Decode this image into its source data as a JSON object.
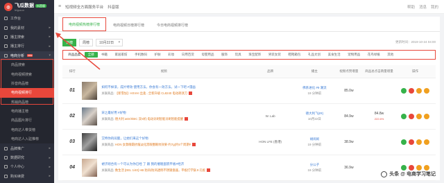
{
  "brand": {
    "name": "飞瓜数据",
    "badge": "抖音版",
    "sub": "feigua.cn"
  },
  "topbar": {
    "menu_icon": "menu-icon",
    "nav1": "短视频全方面服务平台",
    "nav2": "抖音版",
    "right1": "帮助",
    "right2": "消息",
    "right3": "我的"
  },
  "sidebar": {
    "items": [
      {
        "label": "工作台",
        "icon": "desk-icon"
      },
      {
        "label": "我的素材",
        "icon": "folder-icon",
        "arrow": "▸"
      },
      {
        "label": "播主搜索",
        "icon": "search-icon",
        "arrow": "▸"
      },
      {
        "label": "播主排行",
        "icon": "rank-icon",
        "arrow": "▸"
      },
      {
        "label": "电商分析",
        "icon": "cart-icon",
        "arrow": "▾",
        "new": "new"
      }
    ],
    "subitems": [
      "商品搜索",
      "电商视频搜索",
      "抖音商品榜",
      "电商视频排行",
      "热销商品榜",
      "电商播主榜",
      "商品图片排行",
      "电商达人带货榜",
      "电商达人入驻推荐"
    ],
    "items_after": [
      {
        "label": "品牌推广",
        "icon": "brand-icon",
        "arrow": "▸"
      },
      {
        "label": "数据研究",
        "icon": "data-icon",
        "arrow": "▸"
      },
      {
        "label": "个人中心",
        "icon": "user-icon",
        "arrow": "▸"
      },
      {
        "label": "购买续费",
        "icon": "wallet-icon",
        "arrow": "▸"
      }
    ]
  },
  "tabs": [
    "电商视频热榜排行榜",
    "电商视频日榜排行榜",
    "今日电商视频排行榜"
  ],
  "filters": {
    "day": "日榜",
    "week": "周榜",
    "date": "10月22日",
    "updated": "更新时间：2019-10-24 04:00"
  },
  "categories": {
    "label": "商品品类",
    "items": [
      "全部",
      "书籍",
      "家居家纺",
      "手机数码",
      "护肤",
      "彩妆",
      "日用百货",
      "母婴用品",
      "服饰",
      "玩具",
      "珠宝配饰",
      "男装女装",
      "鞋靴箱包",
      "礼品文创",
      "美食生活",
      "宠物用品",
      "花鸟绿植",
      "其他"
    ]
  },
  "table": {
    "headers": [
      "排行",
      "视频",
      "品牌",
      "播主",
      "视频点赞增量",
      "商品总点击销量增量",
      "操作"
    ],
    "rows": [
      {
        "rank": "01",
        "title": "如何不掉漆，成片特效 使用方法，你会有一效方法，试一下吧 #漫画",
        "prod_label": "关联商品:",
        "prod": "【新雪加】HSVHI 丝柔...全新升级 CL8240 电动剃须刀",
        "brand": "",
        "blogger": "佛系进化  #9 潮流",
        "fans": "19 分钟前",
        "likes": "85.0w",
        "sales": "",
        "pct": ""
      },
      {
        "rank": "02",
        "title": "宋之最好用 #好物",
        "prod_label": "关联商品:",
        "prod": "德大利 a6X/I/BIC 双S机-电动牙刷智能牙刷智能提醒",
        "brand": "W. Lab",
        "blogger": "德大利飞(IR)",
        "fans": "10月22日",
        "likes": "84.9w",
        "sales": "84.8w",
        "pct": "222.6%"
      },
      {
        "rank": "03",
        "title": "艾特你的闺蜜，让她们来这个好物",
        "prod_label": "关联商品:",
        "prod": "HON 女款眼霜抗皱淡化黑眼圈眼纹效果-约7g(约5个周期#",
        "brand": "HON LFE (香港)",
        "blogger": "胡闹闹",
        "fans": "19 分钟前",
        "likes": "38.9w",
        "sales": "",
        "pct": ""
      },
      {
        "rank": "04",
        "title": "裙子刚合有一个可以为你已经 了 跟 我的催眠蛋糕平板#经济",
        "prod_label": "关联商品:",
        "prod": "数生活 [DEL 1/40] HB 防风/防风透明不锈钢盘器，平板打学锅 9 孔板",
        "brand": "",
        "blogger": "分公子",
        "fans": "19 分钟前",
        "likes": "36.9w",
        "sales": "",
        "pct": ""
      }
    ]
  },
  "watermark": "头条 @ 电商学习笔记",
  "colors": {
    "accent": "#e8473b",
    "green": "#36b24a",
    "sidebar": "#2b2e3a",
    "link": "#3a7bd5"
  }
}
